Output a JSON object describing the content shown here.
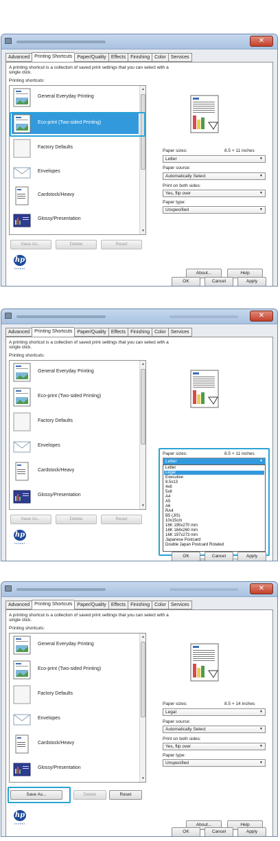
{
  "tabs": [
    "Advanced",
    "Printing Shortcuts",
    "Paper/Quality",
    "Effects",
    "Finishing",
    "Color",
    "Services"
  ],
  "description": "A printing shortcut is a collection of saved print settings that you can select with a single click.",
  "shortcuts_label": "Printing shortcuts:",
  "shortcuts": [
    "General Everyday Printing",
    "Eco-print (Two-sided Printing)",
    "Factory Defaults",
    "Envelopes",
    "Cardstock/Heavy",
    "Glossy/Presentation"
  ],
  "buttons": {
    "save_as": "Save As...",
    "delete": "Delete",
    "reset": "Reset",
    "about": "About...",
    "help": "Help",
    "ok": "OK",
    "cancel": "Cancel",
    "apply": "Apply"
  },
  "logo_text": "invent",
  "paper_sizes_label": "Paper sizes:",
  "paper_source_label": "Paper source:",
  "paper_source_value": "Automatically Select",
  "both_sides_label": "Print on both sides:",
  "both_sides_value": "Yes, flip over",
  "paper_type_label": "Paper type:",
  "paper_type_value": "Unspecified",
  "panel1": {
    "paper_dims": "8.5 × 11 inches",
    "paper_size": "Letter"
  },
  "panel2": {
    "paper_dims": "8.5 × 11 inches",
    "paper_size": "Letter",
    "dropdown_options": [
      "Letter",
      "Legal",
      "Executive",
      "8.5x13",
      "4x6",
      "5x8",
      "A4",
      "A5",
      "A6",
      "RA4",
      "B5 (JIS)",
      "10x15cm",
      "16K 195x270 mm",
      "16K 184x260 mm",
      "16K 197x273 mm",
      "Japanese Postcard",
      "Double Japan Postcard Rotated"
    ],
    "highlighted_option": "Legal"
  },
  "panel3": {
    "paper_dims": "8.5 × 14 inches",
    "paper_size": "Legal"
  },
  "colors": {
    "selection": "#3399dd",
    "callout": "#29a3d6",
    "close": "#c4402a",
    "hp_blue": "#1d4a9a"
  }
}
